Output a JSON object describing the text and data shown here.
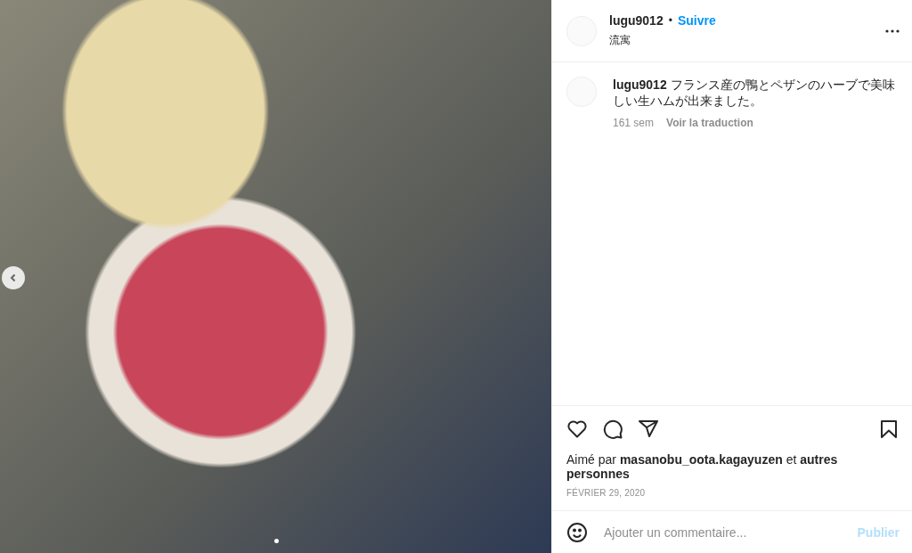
{
  "header": {
    "username": "lugu9012",
    "separator": "•",
    "follow": "Suivre",
    "location": "流寓"
  },
  "caption": {
    "username": "lugu9012",
    "text": "フランス産の鴨とペザンのハーブで美味しい生ハムが出来ました。",
    "age": "161 sem",
    "translate": "Voir la traduction"
  },
  "likes": {
    "prefix": "Aimé par",
    "user": "masanobu_oota.kagayuzen",
    "and": "et",
    "others": "autres personnes"
  },
  "date": "FÉVRIER 29, 2020",
  "comment": {
    "placeholder": "Ajouter un commentaire...",
    "submit": "Publier"
  }
}
